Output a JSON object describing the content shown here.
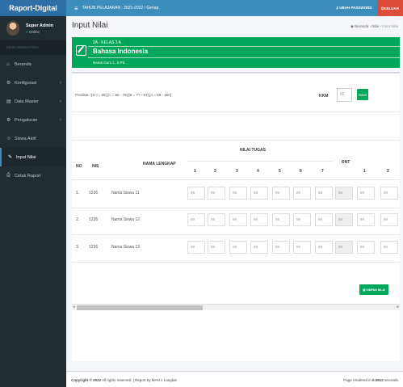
{
  "app": {
    "brand": "Raport-Digital"
  },
  "topbar": {
    "tahun": "TAHUN PELAJARAN : 2021-2022 / Genap",
    "ubah_password": "UBAH PASSWORD",
    "keluar": "KELUAR"
  },
  "user": {
    "name": "Super Admin",
    "status": "Online"
  },
  "sidebar": {
    "header": "MAIN NAVIGATION",
    "items": [
      {
        "label": "Beranda",
        "icon": "home-icon"
      },
      {
        "label": "Konfigurasi",
        "icon": "gears-icon"
      },
      {
        "label": "Data Master",
        "icon": "list-icon"
      },
      {
        "label": "Pengaturan",
        "icon": "gear-icon"
      },
      {
        "label": "Siswa Aktif",
        "icon": "users-icon"
      },
      {
        "label": "Input Nilai",
        "icon": "edit-icon"
      },
      {
        "label": "Cetak Raport",
        "icon": "print-icon"
      }
    ]
  },
  "page": {
    "title": "Input Nilai"
  },
  "breadcrumb": {
    "home": "Beranda",
    "nilai": "Nilai",
    "current": "Input Nilai"
  },
  "info": {
    "kelas": "2A - KELAS 2 A",
    "mapel": "Bahasa Indonesia",
    "guru": "Nama Guru 1, S.Pd."
  },
  "predikat": "Predikat : [D <= 66] [C = 66 - 76] [B = 77 - 87] [A = 88 - 100]",
  "kkm": {
    "label": "KKM",
    "value": "65",
    "save_label": "Save"
  },
  "table": {
    "headers": {
      "no": "NO",
      "nis": "NIS",
      "nama": "NAMA LENGKAP",
      "nilai_tugas": "NILAI TUGAS",
      "rnt": "RNT"
    },
    "tugas_cols": [
      "1",
      "2",
      "3",
      "4",
      "5",
      "6",
      "7"
    ],
    "extra_cols": [
      "1",
      "2"
    ],
    "rows": [
      {
        "no": "1.",
        "nis": "1236",
        "nama": "Nama Siswa 11",
        "values": [
          "89",
          "89",
          "89",
          "89",
          "89",
          "89",
          "89"
        ],
        "rnt": "89",
        "extra": [
          "89",
          "89"
        ]
      },
      {
        "no": "2.",
        "nis": "1236",
        "nama": "Nama Siswa 12",
        "values": [
          "89",
          "89",
          "89",
          "89",
          "89",
          "89",
          "89"
        ],
        "rnt": "89",
        "extra": [
          "89",
          "89"
        ]
      },
      {
        "no": "3.",
        "nis": "1236",
        "nama": "Nama Siswa 13",
        "values": [
          "89",
          "89",
          "89",
          "89",
          "89",
          "89",
          "89"
        ],
        "rnt": "89",
        "extra": [
          "89",
          "89"
        ]
      }
    ]
  },
  "simpan_label": "SIMPAN NILAI",
  "footer": {
    "copyright_bold": "Copyright © 2022",
    "copyright_rest": " All rights reserved. | Report by MAN 1 Langkat",
    "rendered_pre": "Page rendered in ",
    "rendered_time": "0.0812",
    "rendered_post": " seconds."
  }
}
